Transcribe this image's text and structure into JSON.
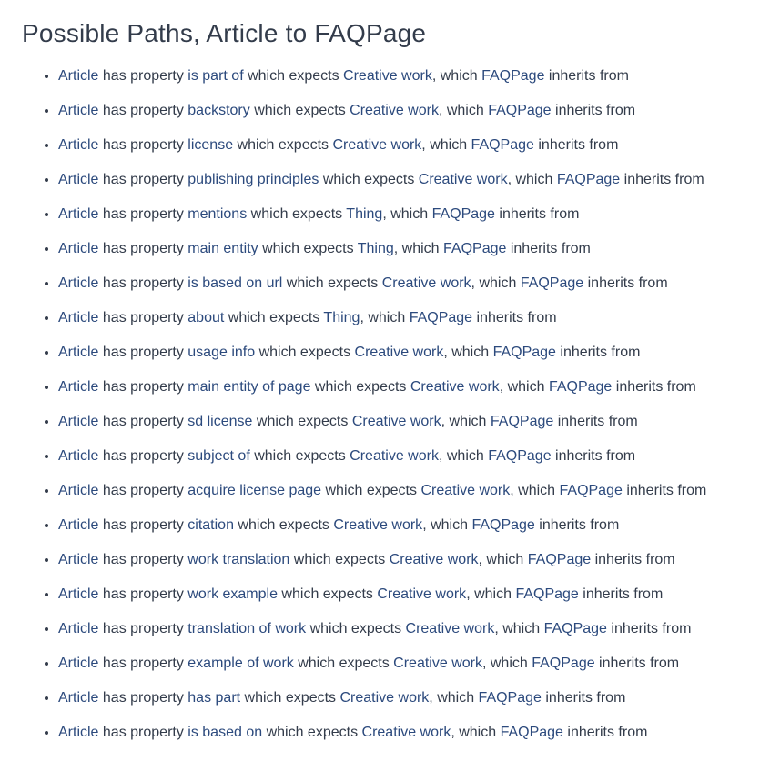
{
  "heading": "Possible Paths, Article to FAQPage",
  "template": {
    "subject": "Article",
    "has_property": " has property ",
    "which_expects": " which expects ",
    "comma_which": ", which ",
    "inherits_from": " inherits from"
  },
  "paths": [
    {
      "property": "is part of",
      "expects": "Creative work",
      "target": "FAQPage"
    },
    {
      "property": "backstory",
      "expects": "Creative work",
      "target": "FAQPage"
    },
    {
      "property": "license",
      "expects": "Creative work",
      "target": "FAQPage"
    },
    {
      "property": "publishing principles",
      "expects": "Creative work",
      "target": "FAQPage"
    },
    {
      "property": "mentions",
      "expects": "Thing",
      "target": "FAQPage"
    },
    {
      "property": "main entity",
      "expects": "Thing",
      "target": "FAQPage"
    },
    {
      "property": "is based on url",
      "expects": "Creative work",
      "target": "FAQPage"
    },
    {
      "property": "about",
      "expects": "Thing",
      "target": "FAQPage"
    },
    {
      "property": "usage info",
      "expects": "Creative work",
      "target": "FAQPage"
    },
    {
      "property": "main entity of page",
      "expects": "Creative work",
      "target": "FAQPage"
    },
    {
      "property": "sd license",
      "expects": "Creative work",
      "target": "FAQPage"
    },
    {
      "property": "subject of",
      "expects": "Creative work",
      "target": "FAQPage"
    },
    {
      "property": "acquire license page",
      "expects": "Creative work",
      "target": "FAQPage"
    },
    {
      "property": "citation",
      "expects": "Creative work",
      "target": "FAQPage"
    },
    {
      "property": "work translation",
      "expects": "Creative work",
      "target": "FAQPage"
    },
    {
      "property": "work example",
      "expects": "Creative work",
      "target": "FAQPage"
    },
    {
      "property": "translation of work",
      "expects": "Creative work",
      "target": "FAQPage"
    },
    {
      "property": "example of work",
      "expects": "Creative work",
      "target": "FAQPage"
    },
    {
      "property": "has part",
      "expects": "Creative work",
      "target": "FAQPage"
    },
    {
      "property": "is based on",
      "expects": "Creative work",
      "target": "FAQPage"
    }
  ]
}
